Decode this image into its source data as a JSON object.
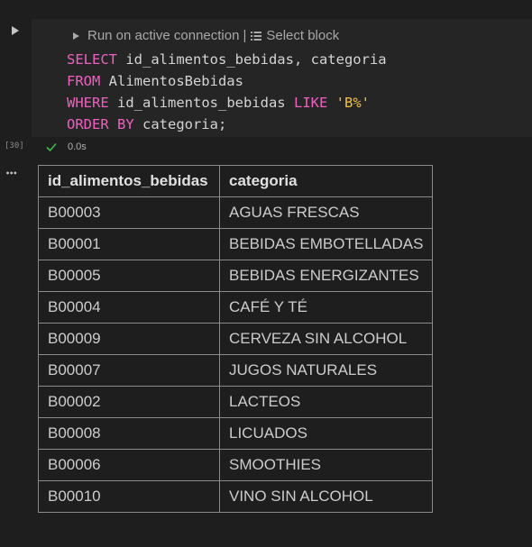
{
  "gutter": {
    "execution_count": "[30]",
    "run_icon": "play-icon",
    "more_icon": "ellipsis-icon",
    "more_label": "•••"
  },
  "toolbar": {
    "run_label": "Run on active connection",
    "separator": "|",
    "select_label": "Select block"
  },
  "code": {
    "line1_kw": "SELECT",
    "line1_rest": " id_alimentos_bebidas, categoria",
    "line2_kw": "FROM",
    "line2_rest": " AlimentosBebidas",
    "line3_kw1": "WHERE",
    "line3_mid": " id_alimentos_bebidas ",
    "line3_kw2": "LIKE",
    "line3_space": " ",
    "line3_str": "'B%'",
    "line4_kw": "ORDER BY",
    "line4_rest": " categoria;"
  },
  "status": {
    "icon": "check-icon",
    "duration": "0.0s"
  },
  "table": {
    "headers": [
      "id_alimentos_bebidas",
      "categoria"
    ],
    "rows": [
      [
        "B00003",
        "AGUAS FRESCAS"
      ],
      [
        "B00001",
        "BEBIDAS EMBOTELLADAS"
      ],
      [
        "B00005",
        "BEBIDAS ENERGIZANTES"
      ],
      [
        "B00004",
        "CAFÉ Y TÉ"
      ],
      [
        "B00009",
        "CERVEZA SIN ALCOHOL"
      ],
      [
        "B00007",
        "JUGOS NATURALES"
      ],
      [
        "B00002",
        "LACTEOS"
      ],
      [
        "B00008",
        "LICUADOS"
      ],
      [
        "B00006",
        "SMOOTHIES"
      ],
      [
        "B00010",
        "VINO SIN ALCOHOL"
      ]
    ]
  },
  "colors": {
    "background": "#1e1e1e",
    "cell_background": "#252526",
    "keyword": "#f060c0",
    "string": "#f0c040",
    "success": "#3fb950"
  }
}
